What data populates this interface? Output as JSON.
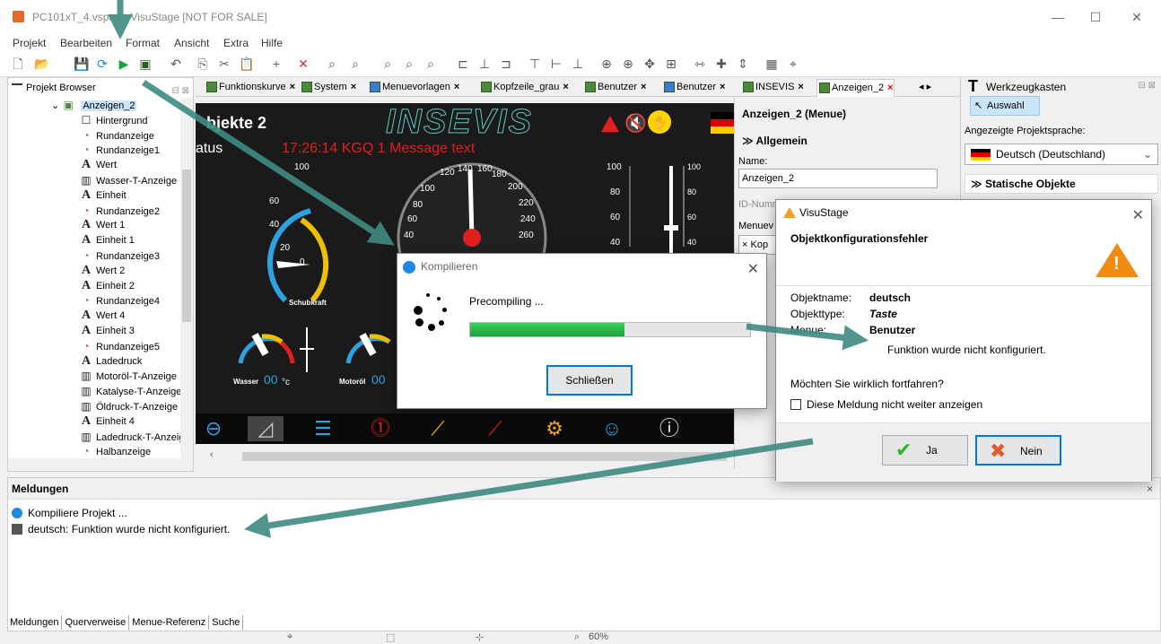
{
  "window": {
    "title": "PC101xT_4.vsproj - VisuStage [NOT FOR SALE]",
    "minimize": "—",
    "maximize": "☐",
    "close": "✕"
  },
  "menu": {
    "items": [
      "Projekt",
      "Bearbeiten",
      "Format",
      "Ansicht",
      "Extra",
      "Hilfe"
    ]
  },
  "project_browser": {
    "title": "Projekt Browser",
    "pin": "⊟ ⊠",
    "root": "Anzeigen_2",
    "items": [
      {
        "label": "Hintergrund",
        "icon": "☐"
      },
      {
        "label": "Rundanzeige",
        "icon": "◔"
      },
      {
        "label": "Rundanzeige1",
        "icon": "◔"
      },
      {
        "label": "Wert",
        "icon": "A"
      },
      {
        "label": "Wasser-T-Anzeige",
        "icon": "▥"
      },
      {
        "label": "Einheit",
        "icon": "A"
      },
      {
        "label": "Rundanzeige2",
        "icon": "◔"
      },
      {
        "label": "Wert 1",
        "icon": "A"
      },
      {
        "label": "Einheit 1",
        "icon": "A"
      },
      {
        "label": "Rundanzeige3",
        "icon": "◔"
      },
      {
        "label": "Wert 2",
        "icon": "A"
      },
      {
        "label": "Einheit 2",
        "icon": "A"
      },
      {
        "label": "Rundanzeige4",
        "icon": "◔"
      },
      {
        "label": "Wert 4",
        "icon": "A"
      },
      {
        "label": "Einheit 3",
        "icon": "A"
      },
      {
        "label": "Rundanzeige5",
        "icon": "◔"
      },
      {
        "label": "Ladedruck",
        "icon": "A"
      },
      {
        "label": "Motoröl-T-Anzeige",
        "icon": "▥"
      },
      {
        "label": "Katalyse-T-Anzeige",
        "icon": "▥"
      },
      {
        "label": "Öldruck-T-Anzeige",
        "icon": "▥"
      },
      {
        "label": "Einheit 4",
        "icon": "A"
      },
      {
        "label": "Ladedruck-T-Anzeige",
        "icon": "▥"
      },
      {
        "label": "Halbanzeige",
        "icon": "◔"
      }
    ]
  },
  "tabs": [
    {
      "label": "Funktionskurve",
      "active": false
    },
    {
      "label": "System",
      "active": false
    },
    {
      "label": "Menuevorlagen",
      "active": false
    },
    {
      "label": "Kopfzeile_grau",
      "active": false
    },
    {
      "label": "Benutzer",
      "active": false
    },
    {
      "label": "Benutzer",
      "active": false
    },
    {
      "label": "INSEVIS",
      "active": false
    },
    {
      "label": "Anzeigen_2",
      "active": true
    }
  ],
  "hmi": {
    "title": "bjekte 2",
    "logo": "INSEVIS",
    "status": "atus",
    "message": "17:26:14 KGQ 1 Message text",
    "gauge_label": "Schubkraft",
    "wasser_label": "Wasser",
    "wasser_value": "00",
    "wasser_unit": "°c",
    "motoroel_label": "Motoröl",
    "motoroel_value": "00"
  },
  "properties": {
    "title": "Anzeigen_2 (Menue)",
    "section": "Allgemein",
    "name_label": "Name:",
    "name_value": "Anzeigen_2",
    "id_label": "ID-Numr",
    "menu_label": "Menuev",
    "menu_value": "Kop"
  },
  "toolbox": {
    "title": "Werkzeugkasten",
    "selection": "Auswahl",
    "language_label": "Angezeigte Projektsprache:",
    "language_value": "Deutsch (Deutschland)",
    "section": "Statische Objekte"
  },
  "compile_dialog": {
    "title": "Kompilieren",
    "step": "Precompiling ...",
    "progress": 0.55,
    "close_button": "Schließen"
  },
  "error_dialog": {
    "title": "VisuStage",
    "heading": "Objektkonfigurationsfehler",
    "object_name_label": "Objektname:",
    "object_name_value": "deutsch",
    "object_type_label": "Objekttype:",
    "object_type_value": "Taste",
    "menu_label": "Menue:",
    "menu_value": "Benutzer",
    "message": "Funktion wurde nicht konfiguriert.",
    "question": "Möchten Sie wirklich fortfahren?",
    "checkbox_label": "Diese Meldung nicht weiter anzeigen",
    "yes_button": "Ja",
    "no_button": "Nein"
  },
  "messages": {
    "title": "Meldungen",
    "rows": [
      "Kompiliere Projekt ...",
      "deutsch: Funktion wurde nicht konfiguriert."
    ],
    "bottom_tabs": [
      "Meldungen",
      "Querverweise",
      "Menue-Referenz",
      "Suche"
    ]
  },
  "status": {
    "zoom": "60%"
  },
  "colors": {
    "arrow": "#3f8a83",
    "accent": "#0078d7",
    "progress": "#1aa23c",
    "warning": "#f08a10"
  }
}
